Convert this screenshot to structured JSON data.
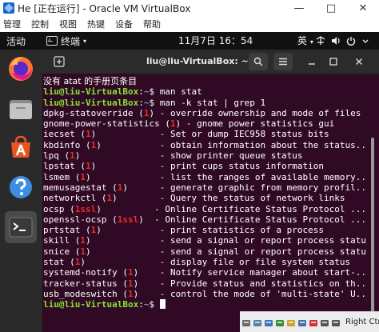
{
  "vbox": {
    "window_title": "He [正在运行] - Oracle VM VirtualBox",
    "controls": {
      "minimize": "—",
      "maximize": "□",
      "close": "✕"
    },
    "menu": [
      "管理",
      "控制",
      "视图",
      "热键",
      "设备",
      "帮助"
    ],
    "status_icons": [
      "hdd-icon",
      "optical-icon",
      "usb-icon",
      "network-icon",
      "shared-folder-icon",
      "display-icon",
      "recording-icon",
      "mouse-icon",
      "keyboard-icon"
    ],
    "host_key": "Right Ctrl"
  },
  "ubuntu": {
    "activities": "活动",
    "app_name": "终端",
    "app_caret": "▾",
    "clock": "11月7日 16：54",
    "ime": "英",
    "ime_caret": "▾"
  },
  "dock": {
    "items": [
      "firefox-icon",
      "files-icon",
      "software-center-icon",
      "help-icon",
      "terminal-icon"
    ]
  },
  "terminal": {
    "title": "liu@liu-VirtualBox: ~",
    "prompt_user": "liu@liu-VirtualBox",
    "prompt_path": "~",
    "prompt_symbol": "$",
    "output": [
      {
        "type": "text",
        "text": "没有 atat 的手册页条目",
        "cjk": true
      },
      {
        "type": "prompt",
        "cmd": " man stat"
      },
      {
        "type": "prompt",
        "cmd": " man -k stat | grep 1"
      },
      {
        "type": "entry",
        "name": "dpkg-statoverride",
        "sec": "1",
        "desc": " - override ownership and mode of files"
      },
      {
        "type": "entry",
        "name": "gnome-power-statistics",
        "sec": "1",
        "desc": " - gnome power statistics gui"
      },
      {
        "type": "entry",
        "name": "iecset",
        "sec": "1",
        "desc": "            - Set or dump IEC958 status bits"
      },
      {
        "type": "entry",
        "name": "kbdinfo",
        "sec": "1",
        "desc": "           - obtain information about the status..."
      },
      {
        "type": "entry",
        "name": "lpq",
        "sec": "1",
        "desc": "               - show printer queue status"
      },
      {
        "type": "entry",
        "name": "lpstat",
        "sec": "1",
        "desc": "            - print cups status information"
      },
      {
        "type": "entry",
        "name": "lsmem",
        "sec": "1",
        "desc": "             - list the ranges of available memory..."
      },
      {
        "type": "entry",
        "name": "memusagestat",
        "sec": "1",
        "desc": "      - generate graphic from memory profil..."
      },
      {
        "type": "entry",
        "name": "networkctl",
        "sec": "1",
        "desc": "        - Query the status of network links"
      },
      {
        "type": "entry",
        "name": "ocsp",
        "sec": "1ssl",
        "desc": "          - Online Certificate Status Protocol ..."
      },
      {
        "type": "entry",
        "name": "openssl-ocsp",
        "sec": "1ssl",
        "desc": "  - Online Certificate Status Protocol ..."
      },
      {
        "type": "entry",
        "name": "prtstat",
        "sec": "1",
        "desc": "           - print statistics of a process"
      },
      {
        "type": "entry",
        "name": "skill",
        "sec": "1",
        "desc": "             - send a signal or report process status"
      },
      {
        "type": "entry",
        "name": "snice",
        "sec": "1",
        "desc": "             - send a signal or report process status"
      },
      {
        "type": "entry",
        "name": "stat",
        "sec": "1",
        "desc": "              - display file or file system status"
      },
      {
        "type": "entry",
        "name": "systemd-notify",
        "sec": "1",
        "desc": "    - Notify service manager about start-..."
      },
      {
        "type": "entry",
        "name": "tracker-status",
        "sec": "1",
        "desc": "    - Provide status and statistics on th..."
      },
      {
        "type": "entry",
        "name": "usb_modeswitch",
        "sec": "1",
        "desc": "    - control the mode of 'multi-state' U..."
      },
      {
        "type": "prompt",
        "cmd": " ",
        "cursor": true
      }
    ]
  }
}
